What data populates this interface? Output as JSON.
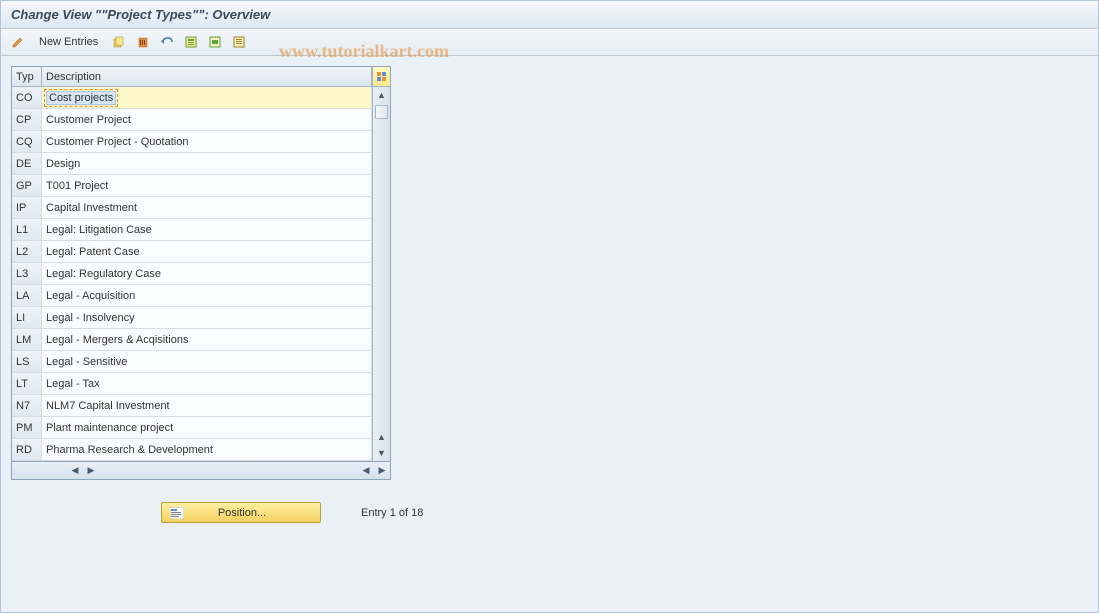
{
  "title": "Change View \"\"Project Types\"\": Overview",
  "toolbar": {
    "new_entries_label": "New Entries"
  },
  "table": {
    "col_typ": "Typ",
    "col_desc": "Description",
    "rows": [
      {
        "typ": "CO",
        "desc": "Cost projects",
        "selected": true
      },
      {
        "typ": "CP",
        "desc": "Customer Project"
      },
      {
        "typ": "CQ",
        "desc": "Customer Project - Quotation"
      },
      {
        "typ": "DE",
        "desc": "Design"
      },
      {
        "typ": "GP",
        "desc": "T001 Project"
      },
      {
        "typ": "IP",
        "desc": "Capital Investment"
      },
      {
        "typ": "L1",
        "desc": "Legal: Litigation Case"
      },
      {
        "typ": "L2",
        "desc": "Legal: Patent Case"
      },
      {
        "typ": "L3",
        "desc": "Legal: Regulatory Case"
      },
      {
        "typ": "LA",
        "desc": "Legal - Acquisition"
      },
      {
        "typ": "LI",
        "desc": "Legal - Insolvency"
      },
      {
        "typ": "LM",
        "desc": "Legal - Mergers & Acqisitions"
      },
      {
        "typ": "LS",
        "desc": "Legal - Sensitive"
      },
      {
        "typ": "LT",
        "desc": "Legal - Tax"
      },
      {
        "typ": "N7",
        "desc": "NLM7 Capital Investment"
      },
      {
        "typ": "PM",
        "desc": "Plant maintenance project"
      },
      {
        "typ": "RD",
        "desc": "Pharma Research & Development"
      }
    ]
  },
  "footer": {
    "position_label": "Position...",
    "entry_status": "Entry 1 of 18"
  },
  "watermark": "www.tutorialkart.com"
}
